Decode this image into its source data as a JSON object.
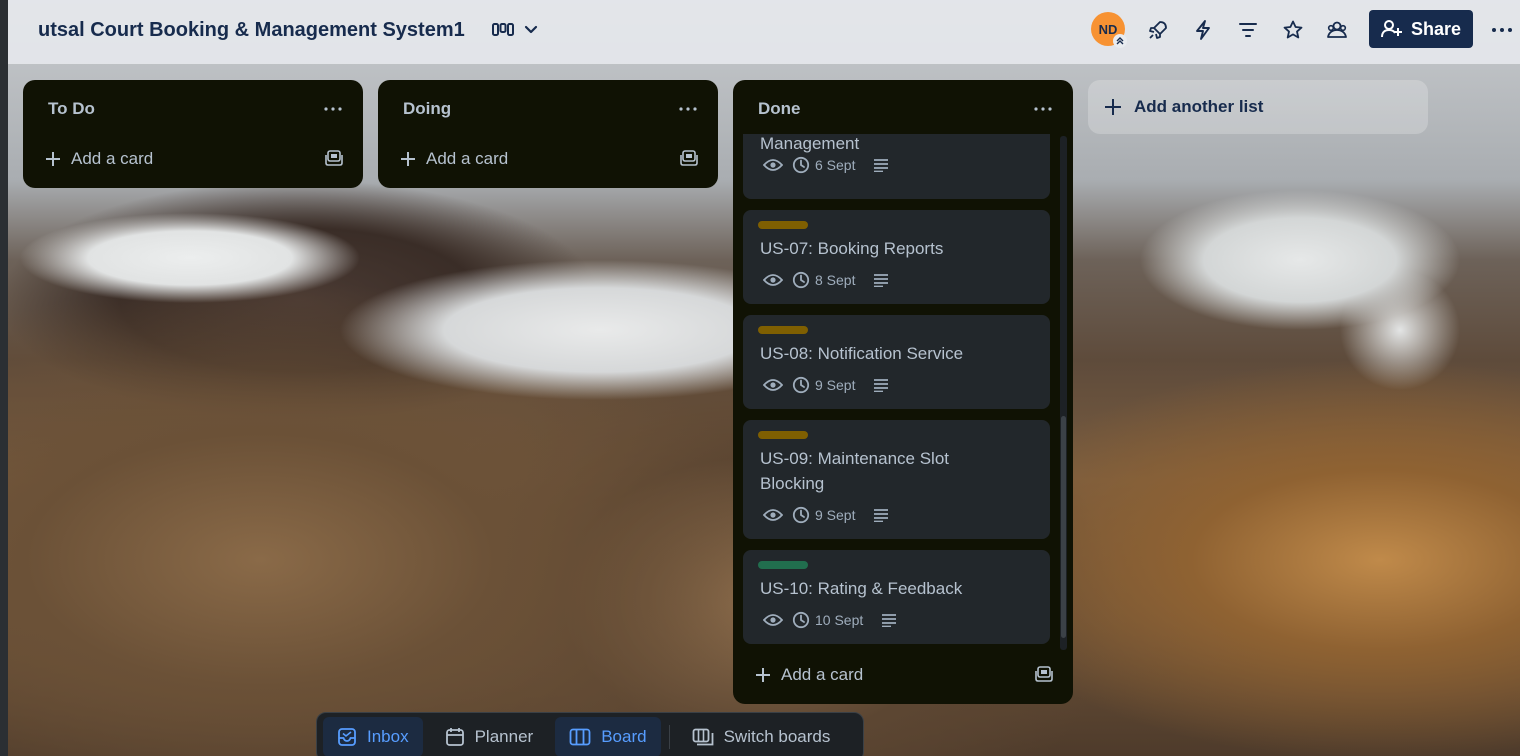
{
  "header": {
    "board_title": "utsal Court Booking & Management System1",
    "view_icon": "board-view-icon",
    "avatar_initials": "ND",
    "share_label": "Share",
    "icons": [
      "power-ups-icon",
      "automation-icon",
      "filter-icon",
      "star-icon",
      "visibility-icon",
      "more-icon"
    ]
  },
  "lists": [
    {
      "title": "To Do",
      "add_card": "Add a card"
    },
    {
      "title": "Doing",
      "add_card": "Add a card"
    },
    {
      "title": "Done",
      "add_card": "Add a card",
      "cards": [
        {
          "title": "Management",
          "label_color": null,
          "date": "6 Sept"
        },
        {
          "title": "US-07: Booking Reports",
          "label_color": "#7f5f01",
          "date": "8 Sept"
        },
        {
          "title": "US-08: Notification Service",
          "label_color": "#7f5f01",
          "date": "9 Sept"
        },
        {
          "title": "US-09: Maintenance Slot Blocking",
          "label_color": "#7f5f01",
          "date": "9 Sept"
        },
        {
          "title": "US-10: Rating & Feedback",
          "label_color": "#216e4e",
          "date": "10 Sept"
        }
      ]
    }
  ],
  "add_list": "Add another list",
  "bottom_bar": {
    "inbox": "Inbox",
    "planner": "Planner",
    "board": "Board",
    "switch_boards": "Switch boards"
  },
  "colors": {
    "list_bg": "#101204",
    "card_bg": "#22272b",
    "share_bg": "#172b4d",
    "avatar_bg": "#f79232",
    "active_blue": "#579dff"
  }
}
